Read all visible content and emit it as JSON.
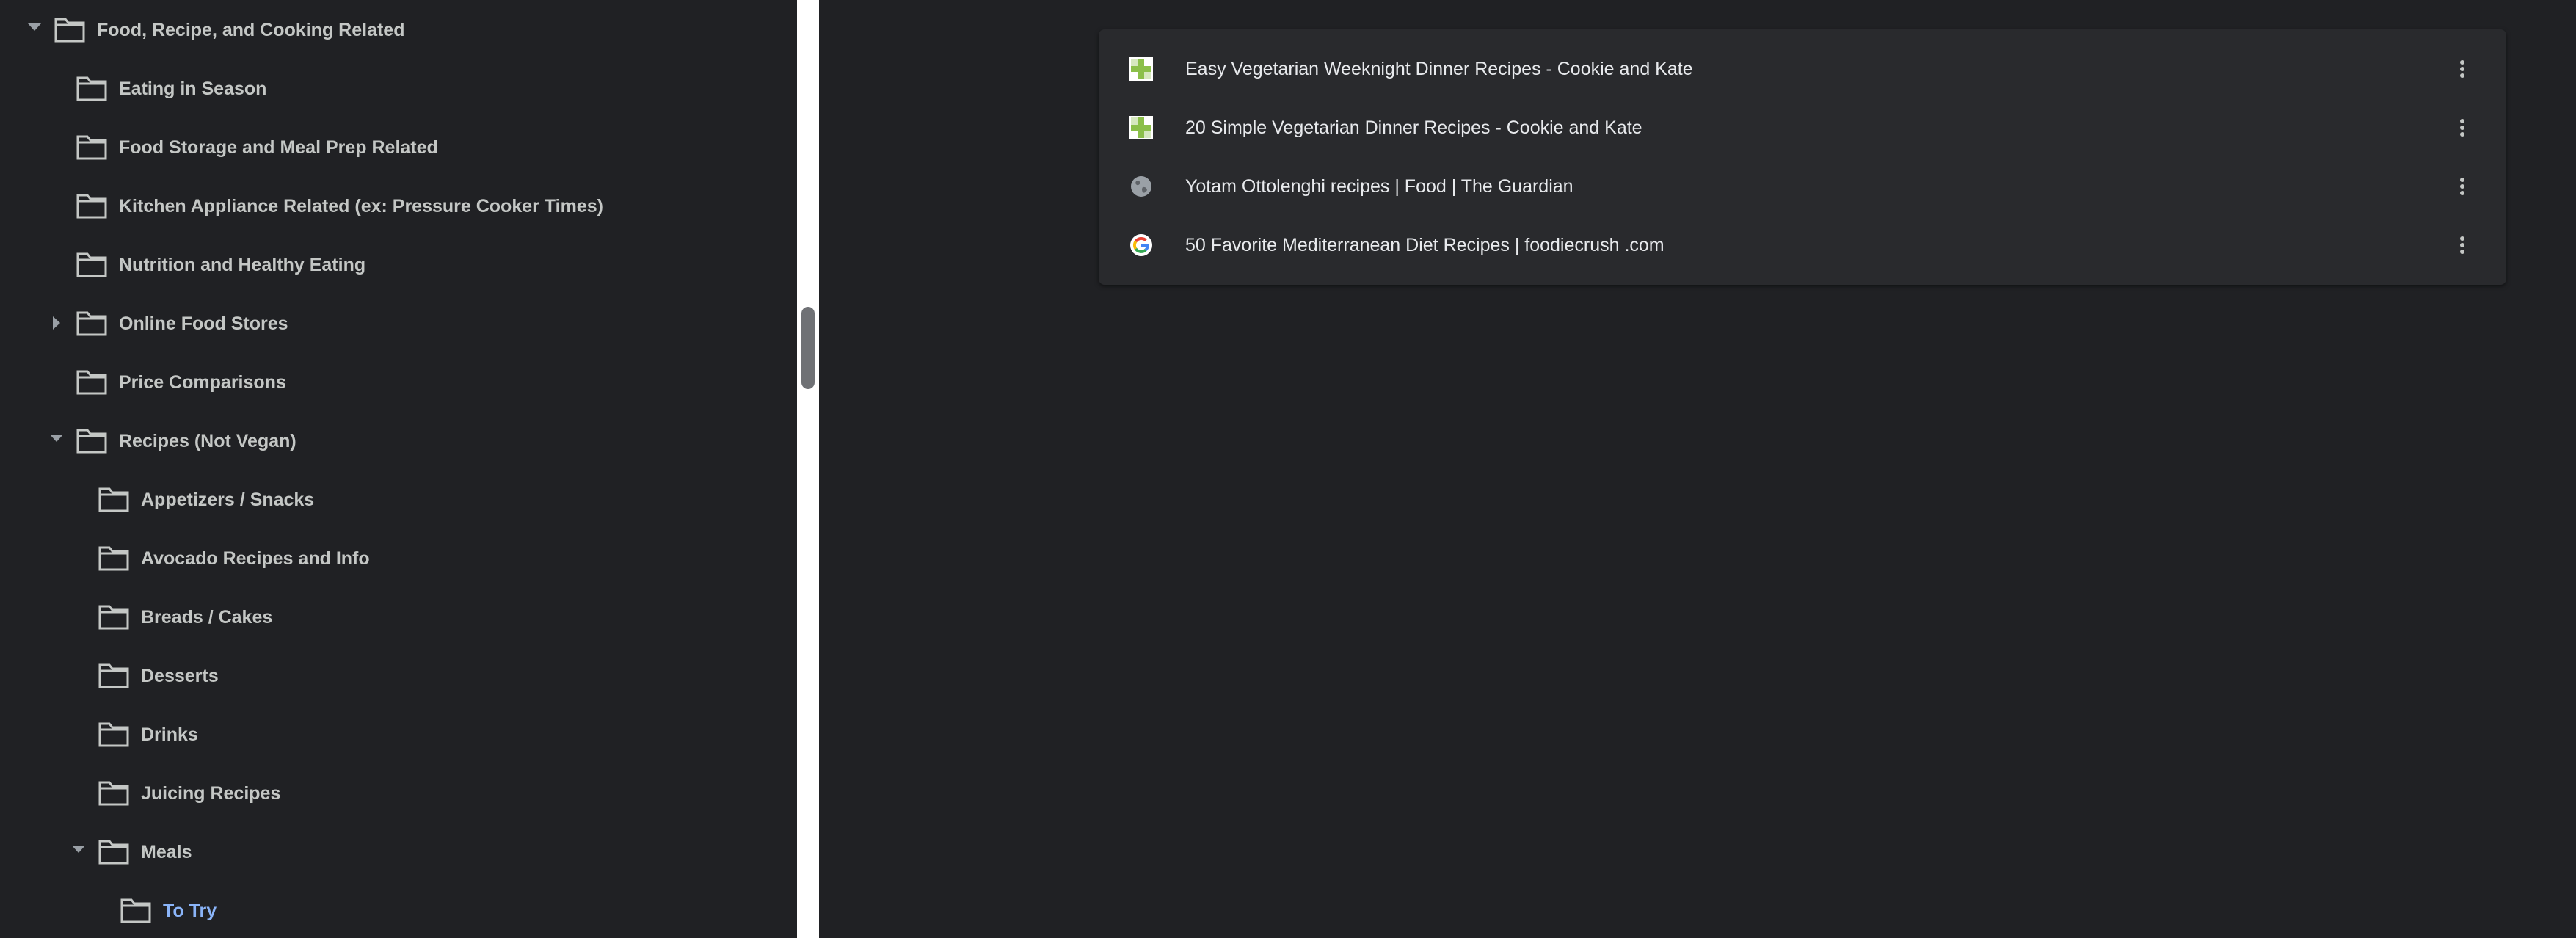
{
  "sidebar": {
    "items": [
      {
        "label": "Food, Recipe, and Cooking Related",
        "expanded": true
      },
      {
        "label": "Eating in Season"
      },
      {
        "label": "Food Storage and Meal Prep Related"
      },
      {
        "label": "Kitchen Appliance Related (ex: Pressure Cooker Times)"
      },
      {
        "label": "Nutrition and Healthy Eating"
      },
      {
        "label": "Online Food Stores",
        "collapsed": true
      },
      {
        "label": "Price Comparisons"
      },
      {
        "label": "Recipes (Not Vegan)",
        "expanded": true
      },
      {
        "label": "Appetizers / Snacks"
      },
      {
        "label": "Avocado Recipes and Info"
      },
      {
        "label": "Breads / Cakes"
      },
      {
        "label": "Desserts"
      },
      {
        "label": "Drinks"
      },
      {
        "label": "Juicing Recipes"
      },
      {
        "label": "Meals",
        "expanded": true
      },
      {
        "label": "To Try",
        "selected": true
      }
    ]
  },
  "bookmarks": [
    {
      "title": "Easy Vegetarian Weeknight Dinner Recipes - Cookie and Kate",
      "icon": "cookie-and-kate-favicon"
    },
    {
      "title": "20 Simple Vegetarian Dinner Recipes - Cookie and Kate",
      "icon": "cookie-and-kate-favicon"
    },
    {
      "title": "Yotam Ottolenghi recipes | Food | The Guardian",
      "icon": "globe-icon"
    },
    {
      "title": "50 Favorite Mediterranean Diet Recipes | foodiecrush .com",
      "icon": "google-icon"
    }
  ],
  "colors": {
    "background": "#202124",
    "card": "#292a2d",
    "selected_text": "#8ab4f8",
    "text": "#e8eaed",
    "muted_text": "#c4c7c5"
  }
}
